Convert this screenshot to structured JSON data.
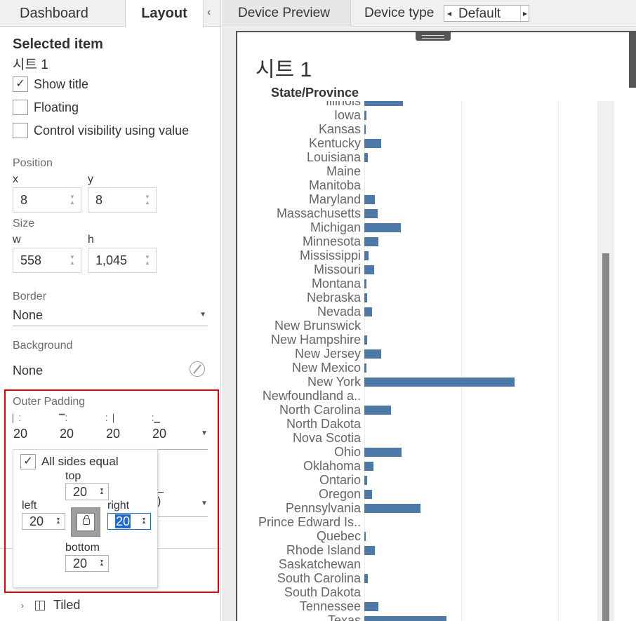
{
  "left_tabs": {
    "dashboard": "Dashboard",
    "layout": "Layout",
    "collapse": "‹"
  },
  "selected": {
    "heading": "Selected item",
    "name": "시트 1",
    "show_title": "Show title",
    "show_title_checked": true,
    "floating": "Floating",
    "control_visibility": "Control visibility using value"
  },
  "position": {
    "label": "Position",
    "x_label": "x",
    "y_label": "y",
    "x": "8",
    "y": "8"
  },
  "size": {
    "label": "Size",
    "w_label": "w",
    "h_label": "h",
    "w": "558",
    "h": "1,045"
  },
  "border": {
    "label": "Border",
    "value": "None"
  },
  "background": {
    "label": "Background",
    "value": "None"
  },
  "outer_padding": {
    "label": "Outer Padding",
    "left": "20",
    "top": "20",
    "right": "20",
    "bottom": "20",
    "popup": {
      "all_sides_equal": "All sides equal",
      "all_sides_equal_checked": true,
      "top_label": "top",
      "left_label": "left",
      "right_label": "right",
      "bottom_label": "bottom",
      "top": "20",
      "left": "20",
      "right": "20",
      "bottom": "20"
    }
  },
  "tiled": {
    "label": "Tiled"
  },
  "top_bar": {
    "device_preview": "Device Preview",
    "device_type_label": "Device type",
    "device_type_value": "Default"
  },
  "sheet": {
    "title": "시트 1"
  },
  "accent_color": "#4e79a7",
  "highlight_color": "#e00000",
  "chart_data": {
    "type": "bar",
    "orientation": "horizontal",
    "column_header": "State/Province",
    "grid": true,
    "categories": [
      "Illinois",
      "Iowa",
      "Kansas",
      "Kentucky",
      "Louisiana",
      "Maine",
      "Manitoba",
      "Maryland",
      "Massachusetts",
      "Michigan",
      "Minnesota",
      "Mississippi",
      "Missouri",
      "Montana",
      "Nebraska",
      "Nevada",
      "New Brunswick",
      "New Hampshire",
      "New Jersey",
      "New Mexico",
      "New York",
      "Newfoundland a..",
      "North Carolina",
      "North Dakota",
      "Nova Scotia",
      "Ohio",
      "Oklahoma",
      "Ontario",
      "Oregon",
      "Pennsylvania",
      "Prince Edward Is..",
      "Quebec",
      "Rhode Island",
      "Saskatchewan",
      "South Carolina",
      "South Dakota",
      "Tennessee",
      "Texas"
    ],
    "values": [
      55,
      3,
      2,
      24,
      5,
      0,
      0,
      15,
      19,
      52,
      20,
      6,
      14,
      3,
      4,
      11,
      0,
      4,
      24,
      3,
      214,
      0,
      38,
      0,
      0,
      53,
      13,
      4,
      11,
      80,
      0,
      2,
      15,
      0,
      5,
      0,
      20,
      117
    ]
  }
}
